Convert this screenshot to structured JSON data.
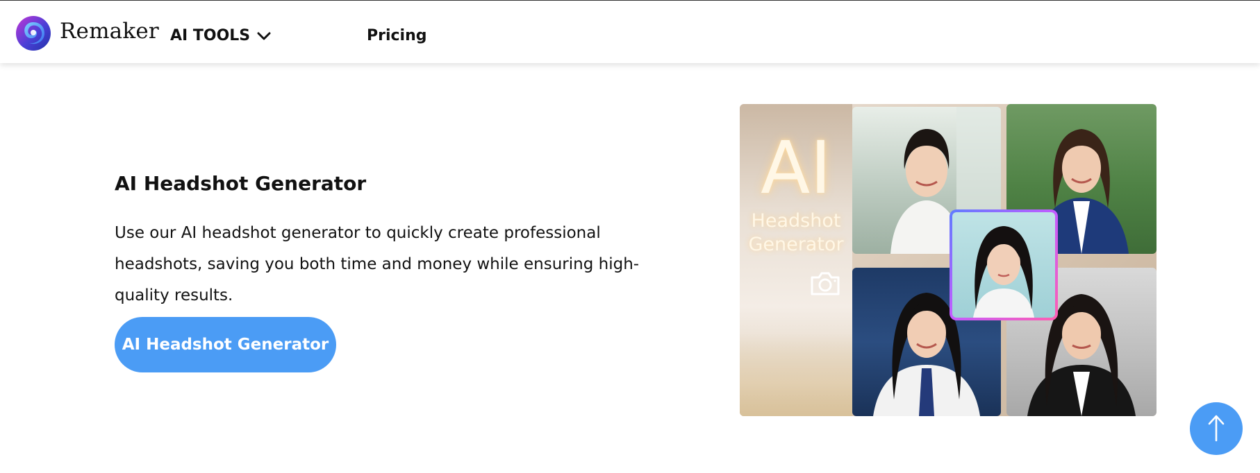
{
  "header": {
    "brand": "Remaker",
    "nav_tools_label": "AI TOOLS",
    "nav_pricing_label": "Pricing"
  },
  "hero": {
    "title": "AI Headshot Generator",
    "description": "Use our AI headshot generator to quickly create professional headshots, saving you both time and money while ensuring high-quality results.",
    "cta_label": "AI Headshot Generator",
    "image": {
      "big_text": "AI",
      "sub_line1": "Headshot",
      "sub_line2": "Generator"
    }
  },
  "scroll_top": {
    "label": "↑"
  },
  "colors": {
    "accent_blue": "#4b9cf5",
    "text": "#111111",
    "background": "#ffffff"
  },
  "icons": [
    "remaker-logo-icon",
    "chevron-down-icon",
    "camera-icon",
    "arrow-up-icon"
  ]
}
